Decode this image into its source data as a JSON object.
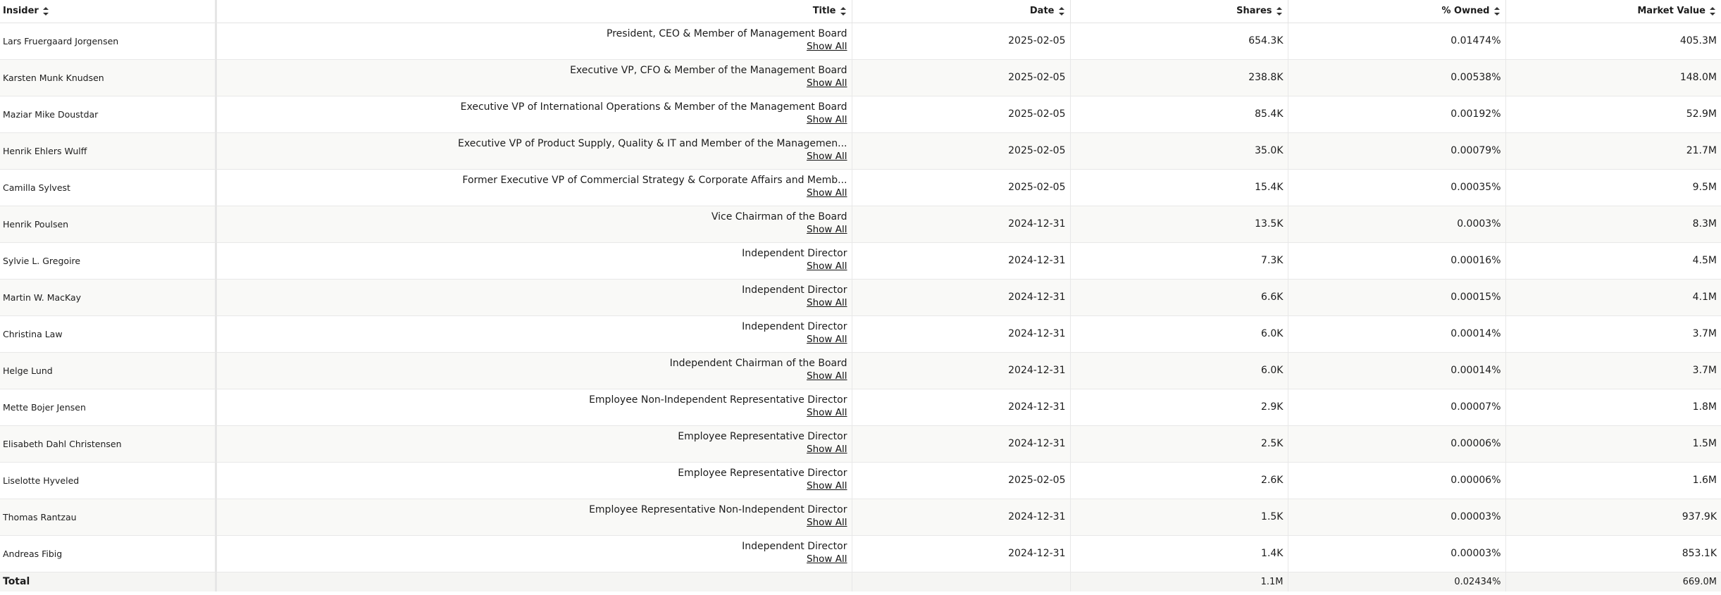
{
  "headers": {
    "insider": "Insider",
    "title": "Title",
    "date": "Date",
    "shares": "Shares",
    "owned": "% Owned",
    "market_value": "Market Value"
  },
  "show_all_label": "Show All",
  "rows": [
    {
      "insider": "Lars Fruergaard Jorgensen",
      "title": "President, CEO & Member of Management Board",
      "date": "2025-02-05",
      "shares": "654.3K",
      "owned": "0.01474%",
      "market_value": "405.3M"
    },
    {
      "insider": "Karsten Munk Knudsen",
      "title": "Executive VP, CFO & Member of the Management Board",
      "date": "2025-02-05",
      "shares": "238.8K",
      "owned": "0.00538%",
      "market_value": "148.0M"
    },
    {
      "insider": "Maziar Mike Doustdar",
      "title": "Executive VP of International Operations & Member of the Management Board",
      "date": "2025-02-05",
      "shares": "85.4K",
      "owned": "0.00192%",
      "market_value": "52.9M"
    },
    {
      "insider": "Henrik Ehlers Wulff",
      "title": "Executive VP of Product Supply, Quality & IT and Member of the Managemen...",
      "date": "2025-02-05",
      "shares": "35.0K",
      "owned": "0.00079%",
      "market_value": "21.7M"
    },
    {
      "insider": "Camilla Sylvest",
      "title": "Former Executive VP of Commercial Strategy & Corporate Affairs and Memb...",
      "date": "2025-02-05",
      "shares": "15.4K",
      "owned": "0.00035%",
      "market_value": "9.5M"
    },
    {
      "insider": "Henrik Poulsen",
      "title": "Vice Chairman of the Board",
      "date": "2024-12-31",
      "shares": "13.5K",
      "owned": "0.0003%",
      "market_value": "8.3M"
    },
    {
      "insider": "Sylvie L. Gregoire",
      "title": "Independent Director",
      "date": "2024-12-31",
      "shares": "7.3K",
      "owned": "0.00016%",
      "market_value": "4.5M"
    },
    {
      "insider": "Martin W. MacKay",
      "title": "Independent Director",
      "date": "2024-12-31",
      "shares": "6.6K",
      "owned": "0.00015%",
      "market_value": "4.1M"
    },
    {
      "insider": "Christina Law",
      "title": "Independent Director",
      "date": "2024-12-31",
      "shares": "6.0K",
      "owned": "0.00014%",
      "market_value": "3.7M"
    },
    {
      "insider": "Helge Lund",
      "title": "Independent Chairman of the Board",
      "date": "2024-12-31",
      "shares": "6.0K",
      "owned": "0.00014%",
      "market_value": "3.7M"
    },
    {
      "insider": "Mette Bojer Jensen",
      "title": "Employee Non-Independent Representative Director",
      "date": "2024-12-31",
      "shares": "2.9K",
      "owned": "0.00007%",
      "market_value": "1.8M"
    },
    {
      "insider": "Elisabeth Dahl Christensen",
      "title": "Employee Representative Director",
      "date": "2024-12-31",
      "shares": "2.5K",
      "owned": "0.00006%",
      "market_value": "1.5M"
    },
    {
      "insider": "Liselotte Hyveled",
      "title": "Employee Representative Director",
      "date": "2025-02-05",
      "shares": "2.6K",
      "owned": "0.00006%",
      "market_value": "1.6M"
    },
    {
      "insider": "Thomas Rantzau",
      "title": "Employee Representative Non-Independent Director",
      "date": "2024-12-31",
      "shares": "1.5K",
      "owned": "0.00003%",
      "market_value": "937.9K"
    },
    {
      "insider": "Andreas Fibig",
      "title": "Independent Director",
      "date": "2024-12-31",
      "shares": "1.4K",
      "owned": "0.00003%",
      "market_value": "853.1K"
    }
  ],
  "total": {
    "label": "Total",
    "shares": "1.1M",
    "owned": "0.02434%",
    "market_value": "669.0M"
  }
}
